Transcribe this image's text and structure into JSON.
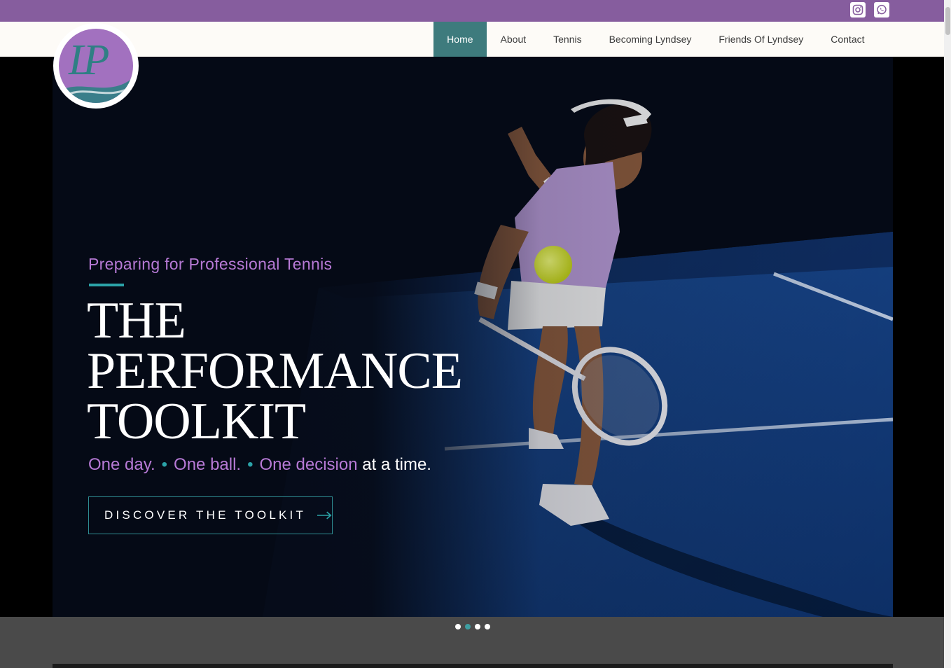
{
  "header": {
    "social": [
      {
        "name": "instagram"
      },
      {
        "name": "whatsapp"
      }
    ],
    "logo_letters": "LP",
    "nav": [
      {
        "label": "Home",
        "active": true
      },
      {
        "label": "About",
        "active": false
      },
      {
        "label": "Tennis",
        "active": false
      },
      {
        "label": "Becoming Lyndsey",
        "active": false
      },
      {
        "label": "Friends Of Lyndsey",
        "active": false
      },
      {
        "label": "Contact",
        "active": false
      }
    ]
  },
  "hero": {
    "eyebrow": "Preparing for Professional Tennis",
    "headline": [
      "THE",
      "PERFORMANCE",
      "TOOLKIT"
    ],
    "tagline": {
      "part1": "One day.",
      "part2": "One ball.",
      "part3": "One decision",
      "part4": "at a time.",
      "separator": "•"
    },
    "cta_label": "DISCOVER THE TOOLKIT",
    "slides_total": 4,
    "active_slide": 2
  },
  "colors": {
    "topbar": "#865d9e",
    "nav_active": "#3e7b7d",
    "accent_purple": "#b77ad6",
    "accent_teal": "#2ba3a8"
  }
}
